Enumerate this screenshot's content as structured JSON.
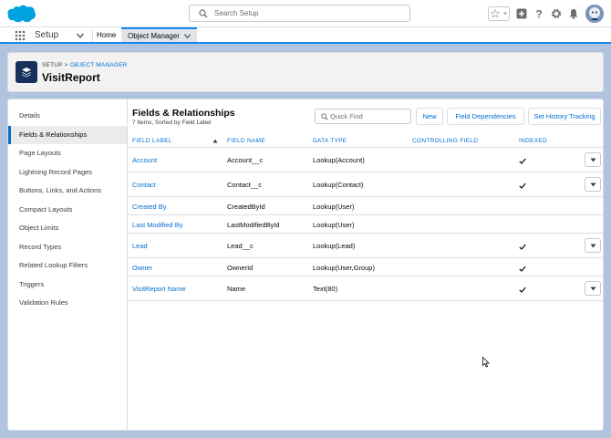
{
  "header": {
    "search_placeholder": "Search Setup"
  },
  "appnav": {
    "app_name": "Setup",
    "home": "Home",
    "active_tab": "Object Manager"
  },
  "pagehead": {
    "breadcrumb_setup": "SETUP",
    "breadcrumb_sep": " > ",
    "breadcrumb_object_manager": "OBJECT MANAGER",
    "title": "VisitReport"
  },
  "sidebar": {
    "items": [
      {
        "label": "Details"
      },
      {
        "label": "Fields & Relationships"
      },
      {
        "label": "Page Layouts"
      },
      {
        "label": "Lightning Record Pages"
      },
      {
        "label": "Buttons, Links, and Actions"
      },
      {
        "label": "Compact Layouts"
      },
      {
        "label": "Object Limits"
      },
      {
        "label": "Record Types"
      },
      {
        "label": "Related Lookup Filters"
      },
      {
        "label": "Triggers"
      },
      {
        "label": "Validation Rules"
      }
    ],
    "active_index": 1
  },
  "main": {
    "title": "Fields & Relationships",
    "subtitle": "7 Items, Sorted by Field Label",
    "quickfind_placeholder": "Quick Find",
    "buttons": {
      "new": "New",
      "field_dependencies": "Field Dependencies",
      "history_tracking": "Set History Tracking"
    },
    "columns": {
      "field_label": "FIELD LABEL",
      "field_name": "FIELD NAME",
      "data_type": "DATA TYPE",
      "controlling_field": "CONTROLLING FIELD",
      "indexed": "INDEXED"
    },
    "rows": [
      {
        "label": "Account",
        "name": "Account__c",
        "type": "Lookup(Account)",
        "indexed": true,
        "menu": true
      },
      {
        "label": "Contact",
        "name": "Contact__c",
        "type": "Lookup(Contact)",
        "indexed": true,
        "menu": true
      },
      {
        "label": "Created By",
        "name": "CreatedById",
        "type": "Lookup(User)",
        "indexed": false,
        "menu": false
      },
      {
        "label": "Last Modified By",
        "name": "LastModifiedById",
        "type": "Lookup(User)",
        "indexed": false,
        "menu": false
      },
      {
        "label": "Lead",
        "name": "Lead__c",
        "type": "Lookup(Lead)",
        "indexed": true,
        "menu": true
      },
      {
        "label": "Owner",
        "name": "OwnerId",
        "type": "Lookup(User,Group)",
        "indexed": true,
        "menu": false
      },
      {
        "label": "VisitReport Name",
        "name": "Name",
        "type": "Text(80)",
        "indexed": true,
        "menu": true
      }
    ]
  },
  "colors": {
    "brand_blue": "#0070d2",
    "cloud_blue": "#00a1e0",
    "page_bg": "#b0c4df",
    "object_icon_bg": "#16325c"
  }
}
